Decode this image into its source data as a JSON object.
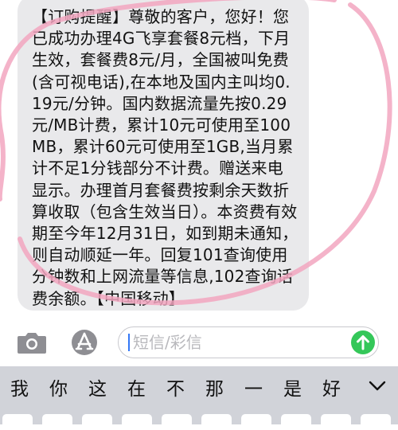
{
  "message": {
    "text": "【订购提醒】尊敬的客户，您好！您已成功办理4G飞享套餐8元档，下月生效，套餐费8元/月，全国被叫免费(含可视电话),在本地及国内主叫均0.19元/分钟。国内数据流量先按0.29元/MB计费，累计10元可使用至100MB，累计60元可使用至1GB,当月累计不足1分钱部分不计费。赠送来电显示。办理首月套餐费按剩余天数折算收取（包含生效当日）。本资费有效期至今年12月31日，如到期未通知，则自动顺延一年。回复101查询使用分钟数和上网流量等信息,102查询话费余额。【中国移动】"
  },
  "compose": {
    "placeholder": "短信/彩信"
  },
  "keyboard": {
    "candidates": [
      "我",
      "你",
      "这",
      "在",
      "不",
      "那",
      "一",
      "是",
      "好"
    ]
  },
  "colors": {
    "bubble": "#e9e9eb",
    "send": "#34c759",
    "keyboard": "#d1d3d9",
    "pen": "#f2a6bf"
  },
  "icons": {
    "camera": "camera-icon",
    "appstore": "app-store-icon",
    "send": "arrow-up-icon",
    "expand": "chevron-down-icon"
  }
}
